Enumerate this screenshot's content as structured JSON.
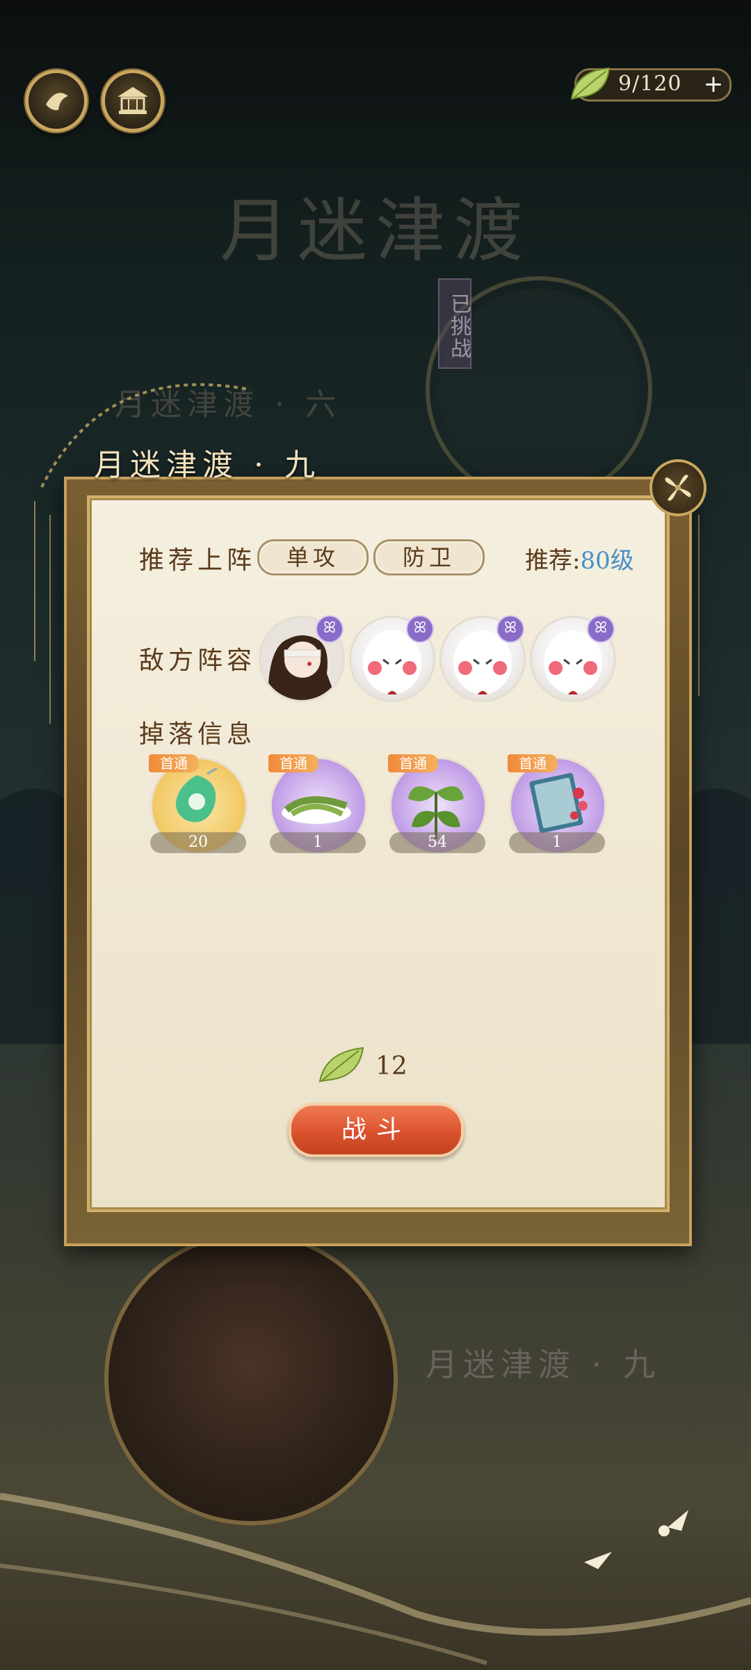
{
  "header": {
    "stamina": "9/120",
    "plus": "+"
  },
  "background": {
    "title": "月迷津渡",
    "challenged_tag": "已挑战",
    "prev_stage": "月迷津渡 · 六",
    "bottom_stage": "月迷津渡 · 九"
  },
  "panel": {
    "stage_title": "月迷津渡 · 九",
    "recommended_label": "推荐上阵",
    "roles": [
      "单攻",
      "防卫"
    ],
    "recommend_prefix": "推荐:",
    "recommend_level": "80级",
    "enemy_label": "敌方阵容",
    "drops_label": "掉落信息",
    "first_clear_tag": "首通",
    "drops": [
      {
        "name": "green-jade-pendant",
        "count": "20",
        "color": "#f0c35a"
      },
      {
        "name": "tea-leaves",
        "count": "1",
        "color": "#b48be0"
      },
      {
        "name": "herb-plant",
        "count": "54",
        "color": "#b48be0"
      },
      {
        "name": "book-with-flowers",
        "count": "1",
        "color": "#b48be0"
      }
    ],
    "cost": "12",
    "battle_label": "战斗"
  },
  "colors": {
    "accent_gold": "#c9a760",
    "level_blue": "#4a90c6",
    "battle_red": "#d8502c"
  }
}
